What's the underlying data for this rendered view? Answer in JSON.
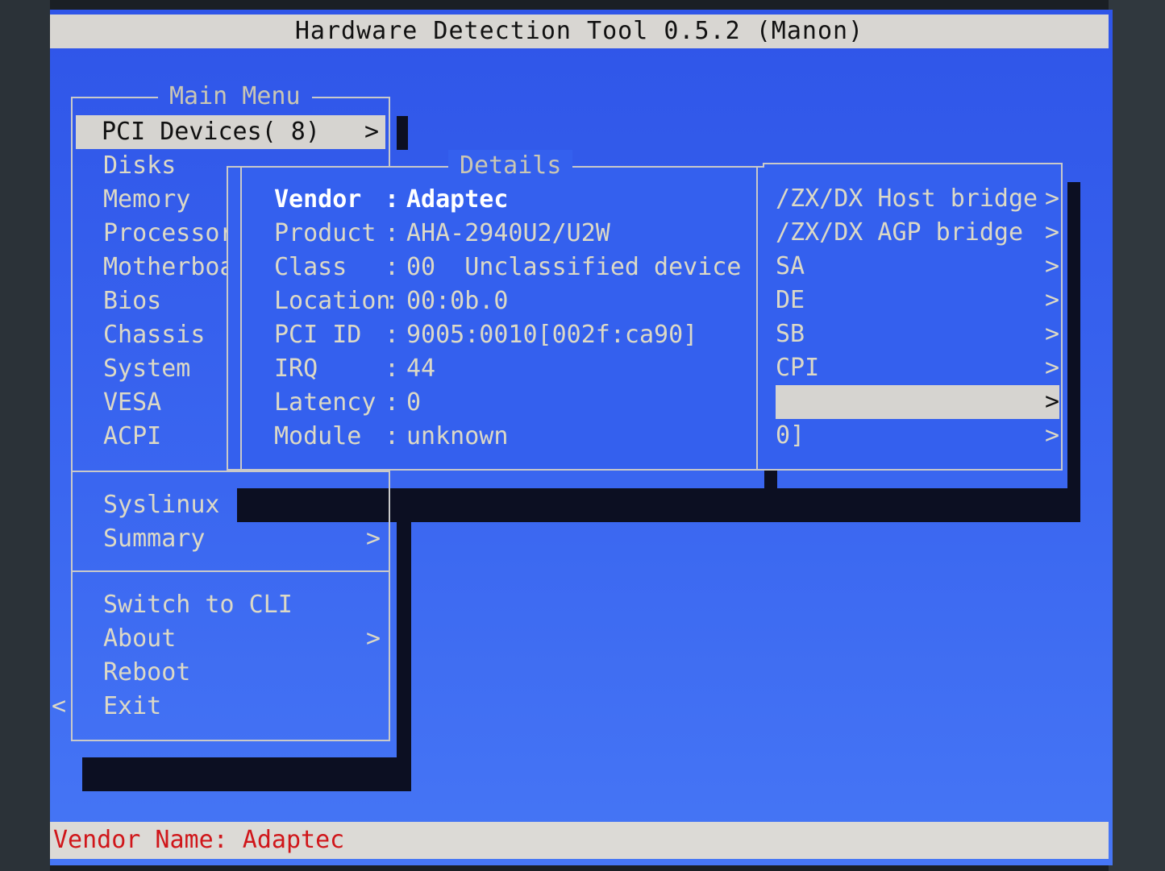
{
  "title": "Hardware Detection Tool 0.5.2 (Manon)",
  "status": "Vendor Name: Adaptec",
  "main_menu": {
    "title": "Main Menu",
    "items": [
      {
        "label": "PCI Devices( 8)",
        "arrow": ">",
        "selected": true
      },
      {
        "label": "Disks"
      },
      {
        "label": "Memory"
      },
      {
        "label": "Processor"
      },
      {
        "label": "Motherboa"
      },
      {
        "label": "Bios"
      },
      {
        "label": "Chassis"
      },
      {
        "label": "System"
      },
      {
        "label": "VESA"
      },
      {
        "label": "ACPI"
      }
    ],
    "group2": [
      {
        "label": "Syslinux"
      },
      {
        "label": "Summary",
        "arrow": ">"
      }
    ],
    "group3": [
      {
        "label": "Switch to CLI"
      },
      {
        "label": "About",
        "arrow": ">"
      },
      {
        "label": "Reboot"
      },
      {
        "label": "Exit",
        "prefix": "<"
      }
    ]
  },
  "pci_list": {
    "items": [
      {
        "label": "/ZX/DX Host bridge",
        "arrow": ">"
      },
      {
        "label": "/ZX/DX AGP bridge",
        "arrow": ">"
      },
      {
        "label": "SA",
        "arrow": ">"
      },
      {
        "label": "DE",
        "arrow": ">"
      },
      {
        "label": "SB",
        "arrow": ">"
      },
      {
        "label": "CPI",
        "arrow": ">"
      },
      {
        "label": "",
        "arrow": ">",
        "selected": true
      },
      {
        "label": "0]",
        "arrow": ">"
      }
    ]
  },
  "details": {
    "title": "Details",
    "rows": [
      {
        "key": "Vendor",
        "sep": ":",
        "value": "Adaptec"
      },
      {
        "key": "Product",
        "sep": ":",
        "value": "AHA-2940U2/U2W"
      },
      {
        "key": "Class",
        "sep": ":",
        "value": "00  Unclassified device"
      },
      {
        "key": "Location",
        "sep": ":",
        "value": "00:0b.0"
      },
      {
        "key": "PCI ID",
        "sep": ":",
        "value": "9005:0010[002f:ca90]"
      },
      {
        "key": "IRQ",
        "sep": ":",
        "value": "44"
      },
      {
        "key": "Latency",
        "sep": ":",
        "value": "0"
      },
      {
        "key": "Module",
        "sep": ":",
        "value": "unknown"
      }
    ]
  },
  "colors": {
    "screen_blue": "#3a66f0",
    "bar_gray": "#d8d6d2",
    "status_red": "#d0161a",
    "text": "#dcd9c6"
  }
}
